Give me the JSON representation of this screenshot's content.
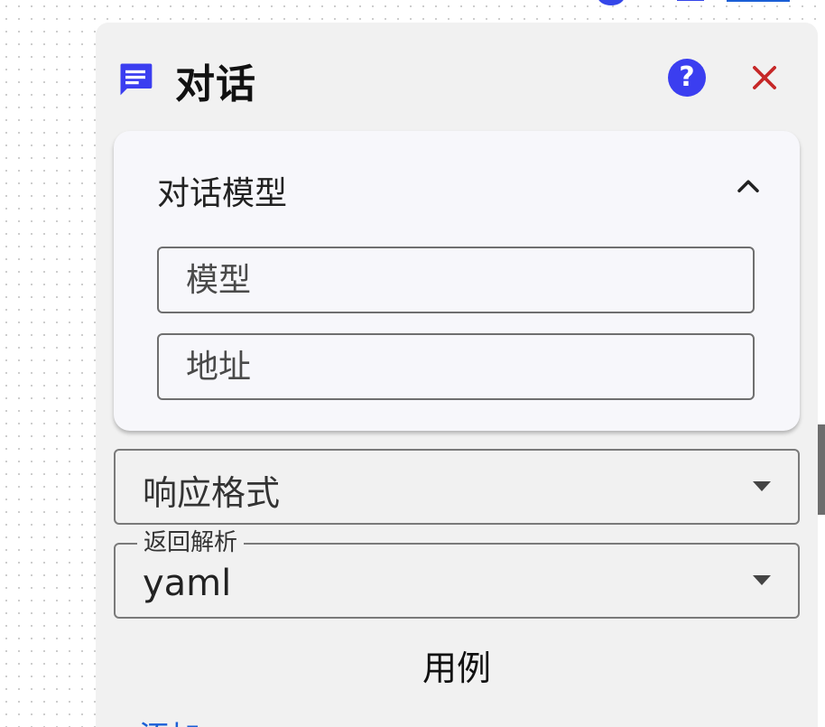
{
  "dialog": {
    "title": "对话",
    "help_label": "?",
    "icons": {
      "title": "chat-icon",
      "help": "help-icon",
      "close": "close-icon",
      "collapse": "chevron-up-icon",
      "dropdown": "dropdown-arrow-icon"
    },
    "colors": {
      "accent": "#3b3ef0",
      "close": "#c62828",
      "link": "#1b5fd6"
    }
  },
  "model_section": {
    "title": "对话模型",
    "expanded": true,
    "fields": {
      "model": {
        "placeholder": "模型",
        "value": ""
      },
      "address": {
        "placeholder": "地址",
        "value": ""
      }
    }
  },
  "response_format": {
    "placeholder": "响应格式",
    "value": ""
  },
  "return_parse": {
    "label": "返回解析",
    "value": "yaml"
  },
  "examples": {
    "title": "用例",
    "add_label": "添加"
  }
}
